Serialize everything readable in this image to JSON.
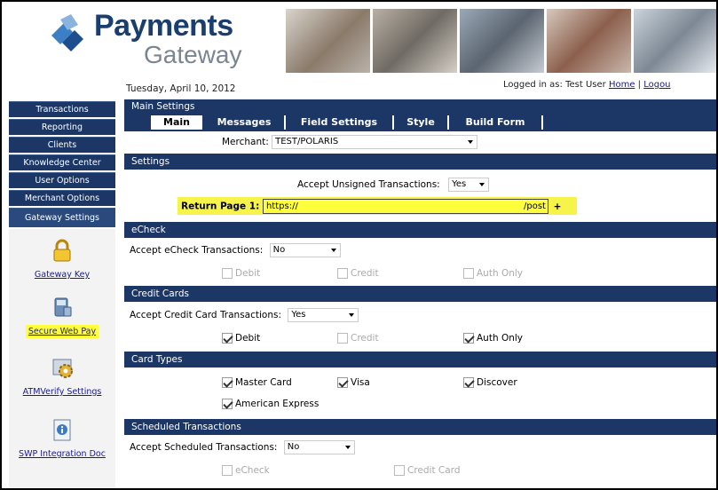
{
  "brand": {
    "title": "Payments",
    "subtitle": "Gateway",
    "accent": "#1c3766"
  },
  "header": {
    "date": "Tuesday, April 10, 2012",
    "logged_in_label": "Logged in as:",
    "user": "Test User",
    "home_link": "Home",
    "logout_link": "Logou"
  },
  "sidebar": {
    "items": [
      {
        "label": "Transactions"
      },
      {
        "label": "Reporting"
      },
      {
        "label": "Clients"
      },
      {
        "label": "Knowledge Center"
      },
      {
        "label": "User Options"
      },
      {
        "label": "Merchant Options"
      },
      {
        "label": "Gateway Settings"
      }
    ],
    "links": [
      {
        "label": "Gateway Key",
        "icon": "lock-icon"
      },
      {
        "label": "Secure Web Pay",
        "icon": "terminal-icon"
      },
      {
        "label": "ATMVerify Settings",
        "icon": "gear-icon"
      },
      {
        "label": "SWP Integration Doc",
        "icon": "info-doc-icon"
      }
    ]
  },
  "main": {
    "section_title": "Main Settings",
    "tabs": [
      {
        "label": "Main"
      },
      {
        "label": "Messages"
      },
      {
        "label": "Field Settings"
      },
      {
        "label": "Style"
      },
      {
        "label": "Build Form"
      }
    ],
    "merchant_label": "Merchant:",
    "merchant_value": "TEST/POLARIS",
    "settings": {
      "title": "Settings",
      "unsigned_label": "Accept Unsigned Transactions:",
      "unsigned_value": "Yes",
      "return_label": "Return Page 1:",
      "return_value": "https://",
      "return_value_tail": "/post",
      "add_label": "+"
    },
    "echeck": {
      "title": "eCheck",
      "accept_label": "Accept eCheck Transactions:",
      "accept_value": "No",
      "debit": "Debit",
      "credit": "Credit",
      "auth_only": "Auth Only"
    },
    "credit_cards": {
      "title": "Credit Cards",
      "accept_label": "Accept Credit Card Transactions:",
      "accept_value": "Yes",
      "debit": "Debit",
      "credit": "Credit",
      "auth_only": "Auth Only"
    },
    "card_types": {
      "title": "Card Types",
      "master": "Master Card",
      "visa": "Visa",
      "discover": "Discover",
      "amex": "American Express"
    },
    "scheduled": {
      "title": "Scheduled Transactions",
      "accept_label": "Accept Scheduled Transactions:",
      "accept_value": "No",
      "echeck": "eCheck",
      "credit_card": "Credit Card"
    }
  }
}
